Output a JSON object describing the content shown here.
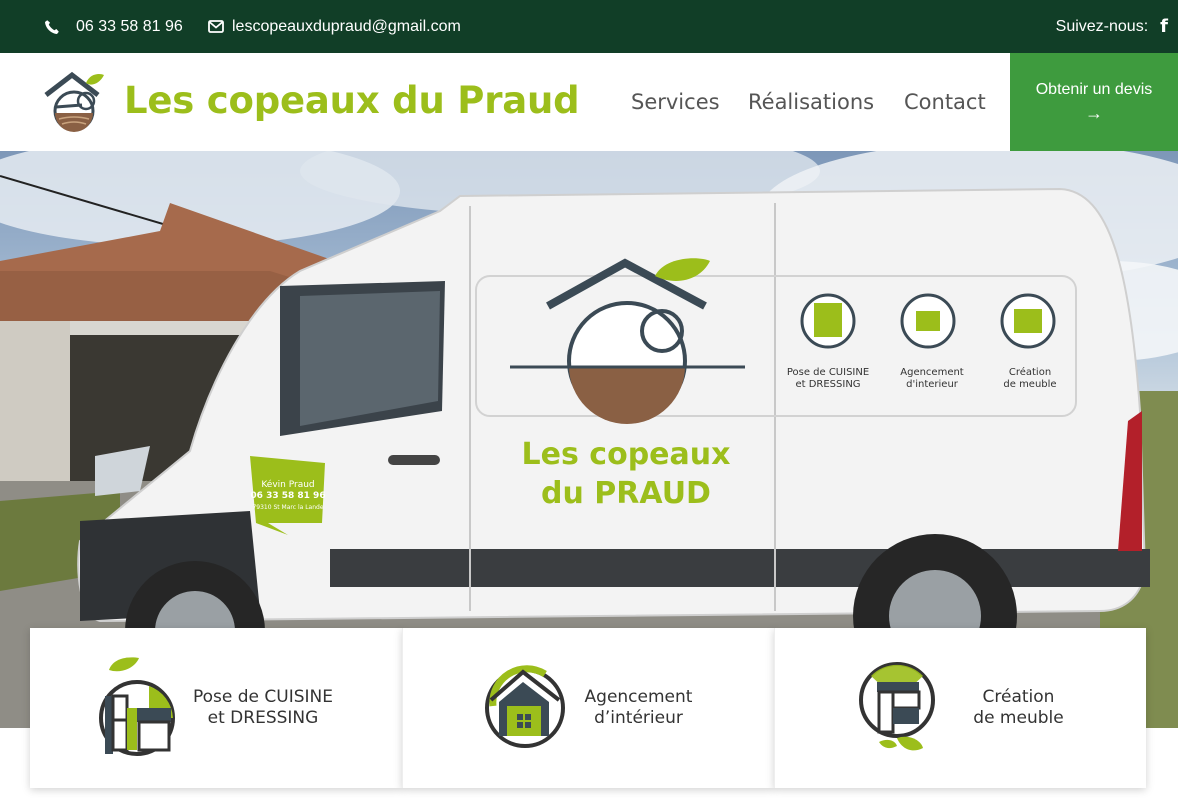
{
  "topbar": {
    "phone": "06 33 58 81 96",
    "email": "lescopeauxdupraud@gmail.com",
    "follow_label": "Suivez-nous:",
    "phone_icon": "phone-icon",
    "email_icon": "envelope-icon",
    "social_icon": "facebook-icon",
    "social_glyph": "f"
  },
  "header": {
    "brand": "Les copeaux du Praud",
    "nav": [
      "Services",
      "Réalisations",
      "Contact"
    ],
    "cta_label": "Obtenir un devis",
    "cta_arrow": "→"
  },
  "hero": {
    "van_text_line1": "Les copeaux",
    "van_text_line2": "du PRAUD",
    "van_services": [
      "Pose de CUISINE",
      "et DRESSING",
      "Agencement",
      "d'interieur",
      "Création",
      "de meuble"
    ],
    "van_card": [
      "Kévin Praud",
      "06 33 58 81 96",
      "79310 St Marc la Lande"
    ]
  },
  "cards": [
    {
      "label": "Pose de CUISINE\net DRESSING",
      "icon": "kitchen-cabinet-icon"
    },
    {
      "label": "Agencement\nd’intérieur",
      "icon": "house-interior-icon"
    },
    {
      "label": "Création\nde meuble",
      "icon": "furniture-drawers-icon"
    }
  ],
  "colors": {
    "topbar_bg": "#113e27",
    "brand_green": "#9cbe1b",
    "cta_bg": "#3e9b3e",
    "nav_text": "#555555"
  }
}
